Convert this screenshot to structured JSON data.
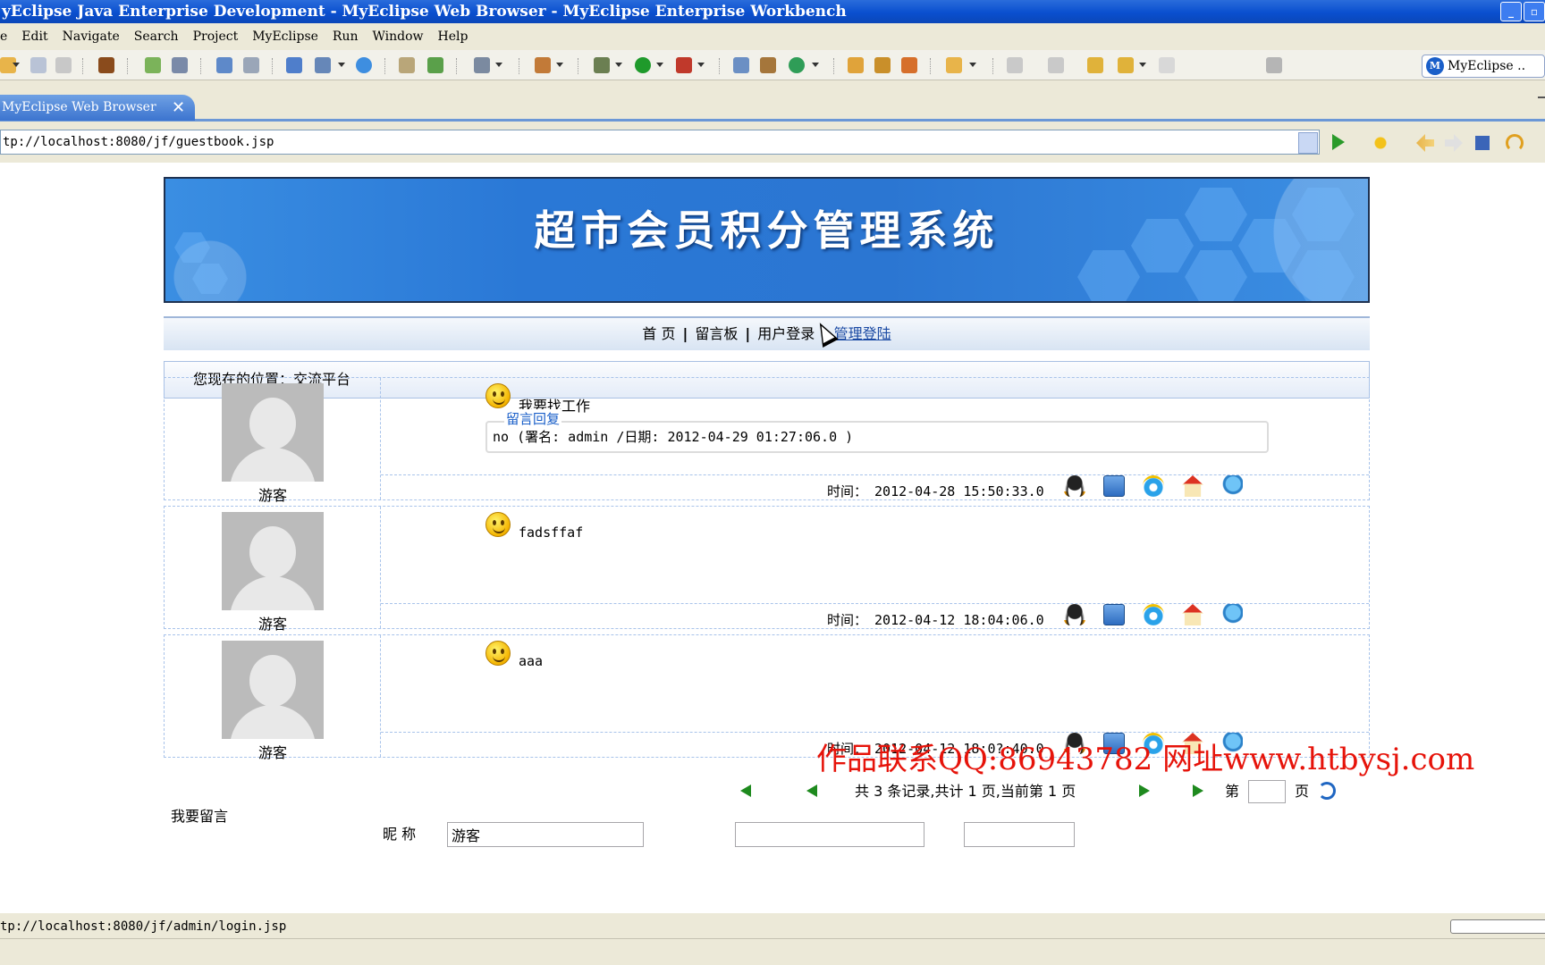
{
  "window": {
    "title": "yEclipse Java Enterprise Development - MyEclipse Web Browser - MyEclipse Enterprise Workbench"
  },
  "menu": [
    "e",
    "Edit",
    "Navigate",
    "Search",
    "Project",
    "MyEclipse",
    "Run",
    "Window",
    "Help"
  ],
  "perspective": {
    "label": "MyEclipse ..",
    "icon": "myeclipse-perspective-icon"
  },
  "tab": {
    "label": "MyEclipse Web Browser",
    "close": "✕"
  },
  "url": {
    "value": "tp://localhost:8080/jf/guestbook.jsp"
  },
  "page": {
    "banner_title": "超市会员积分管理系统",
    "nav": {
      "home": "首 页",
      "guestbook": "留言板",
      "user_login": "用户登录",
      "admin_login": "管理登陆"
    },
    "location": "您现在的位置：交流平台",
    "messages": [
      {
        "author": "游客",
        "text": "我要找工作",
        "reply_legend": "留言回复",
        "reply": "no (署名: admin /日期: 2012-04-29 01:27:06.0 )",
        "time_label": "时间：",
        "time": "2012-04-28 15:50:33.0"
      },
      {
        "author": "游客",
        "text": "fadsffaf",
        "time_label": "时间：",
        "time": "2012-04-12 18:04:06.0"
      },
      {
        "author": "游客",
        "text": "aaa",
        "time_label": "时间：",
        "time": "2012-04-12 18:0?:40.0"
      }
    ],
    "pager": {
      "summary": "共 3 条记录,共计 1 页,当前第 1 页",
      "goto_prefix": "第",
      "goto_suffix": "页"
    },
    "leave_message": {
      "title": "我要留言",
      "nick_label": "昵  称",
      "nick_value": "游客"
    },
    "watermark": "作品联系QQ:86943782 网址www.htbysj.com"
  },
  "status": {
    "text": "tp://localhost:8080/jf/admin/login.jsp"
  }
}
